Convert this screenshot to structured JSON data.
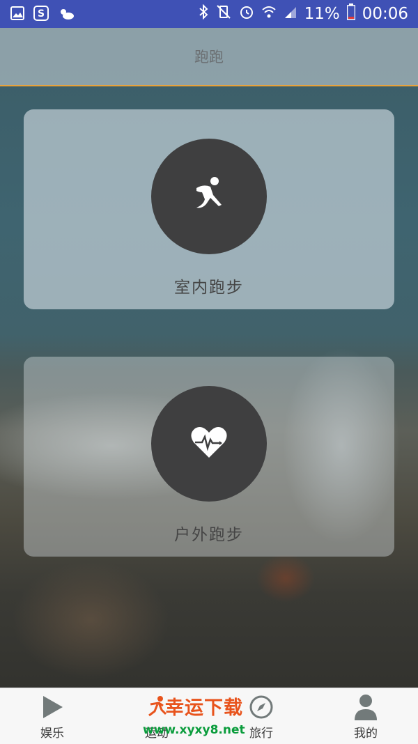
{
  "status_bar": {
    "battery_percent": "11%",
    "time": "00:06",
    "left_icons": [
      "gallery-icon",
      "s-app-icon",
      "weather-icon"
    ],
    "right_icons": [
      "bluetooth-icon",
      "vibrate-mute-icon",
      "alarm-icon",
      "wifi-icon",
      "signal-icon",
      "battery-icon"
    ]
  },
  "header": {
    "title": "跑跑"
  },
  "cards": [
    {
      "label": "室内跑步",
      "icon": "runner-icon"
    },
    {
      "label": "户外跑步",
      "icon": "heart-pulse-icon"
    }
  ],
  "bottom_nav": [
    {
      "label": "娱乐",
      "icon": "play-icon"
    },
    {
      "label": "运动",
      "icon": "running-icon"
    },
    {
      "label": "旅行",
      "icon": "compass-icon"
    },
    {
      "label": "我的",
      "icon": "person-icon"
    }
  ],
  "watermark": {
    "title": "幸运下载",
    "url": "www.xyxy8.net"
  },
  "colors": {
    "status_bar": "#3f51b5",
    "accent_line": "#e8a23a",
    "circle": "#3f3f40",
    "watermark_orange": "#e8531c",
    "watermark_green": "#0a9c3c"
  }
}
